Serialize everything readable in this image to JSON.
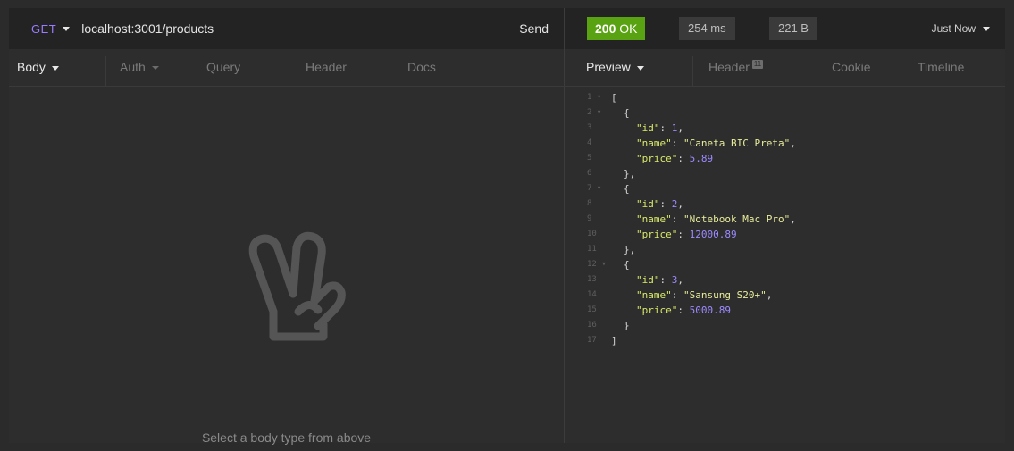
{
  "request": {
    "method": "GET",
    "url": "localhost:3001/products",
    "send_label": "Send"
  },
  "request_tabs": [
    {
      "label": "Body",
      "active": true
    },
    {
      "label": "Auth"
    },
    {
      "label": "Query"
    },
    {
      "label": "Header"
    },
    {
      "label": "Docs"
    }
  ],
  "body_empty": {
    "icon": "peace-hand-icon",
    "message": "Select a body type from above"
  },
  "response": {
    "status_code": "200",
    "status_text": "OK",
    "status_color": "#59a211",
    "time": "254 ms",
    "size": "221 B",
    "history": "Just Now"
  },
  "response_tabs": [
    {
      "label": "Preview",
      "active": true
    },
    {
      "label": "Header",
      "badge": "11"
    },
    {
      "label": "Cookie"
    },
    {
      "label": "Timeline"
    }
  ],
  "json_lines": [
    {
      "n": "1",
      "fold": true,
      "parts": [
        [
          "p",
          "["
        ]
      ],
      "indent": 0
    },
    {
      "n": "2",
      "fold": true,
      "parts": [
        [
          "p",
          "{"
        ]
      ],
      "indent": 1
    },
    {
      "n": "3",
      "parts": [
        [
          "k",
          "\"id\""
        ],
        [
          "p",
          ": "
        ],
        [
          "n",
          "1"
        ],
        [
          "p",
          ","
        ]
      ],
      "indent": 2
    },
    {
      "n": "4",
      "parts": [
        [
          "k",
          "\"name\""
        ],
        [
          "p",
          ": "
        ],
        [
          "s",
          "\"Caneta BIC Preta\""
        ],
        [
          "p",
          ","
        ]
      ],
      "indent": 2
    },
    {
      "n": "5",
      "parts": [
        [
          "k",
          "\"price\""
        ],
        [
          "p",
          ": "
        ],
        [
          "n",
          "5.89"
        ]
      ],
      "indent": 2
    },
    {
      "n": "6",
      "parts": [
        [
          "p",
          "},"
        ]
      ],
      "indent": 1
    },
    {
      "n": "7",
      "fold": true,
      "parts": [
        [
          "p",
          "{"
        ]
      ],
      "indent": 1
    },
    {
      "n": "8",
      "parts": [
        [
          "k",
          "\"id\""
        ],
        [
          "p",
          ": "
        ],
        [
          "n",
          "2"
        ],
        [
          "p",
          ","
        ]
      ],
      "indent": 2
    },
    {
      "n": "9",
      "parts": [
        [
          "k",
          "\"name\""
        ],
        [
          "p",
          ": "
        ],
        [
          "s",
          "\"Notebook Mac Pro\""
        ],
        [
          "p",
          ","
        ]
      ],
      "indent": 2
    },
    {
      "n": "10",
      "parts": [
        [
          "k",
          "\"price\""
        ],
        [
          "p",
          ": "
        ],
        [
          "n",
          "12000.89"
        ]
      ],
      "indent": 2
    },
    {
      "n": "11",
      "parts": [
        [
          "p",
          "},"
        ]
      ],
      "indent": 1
    },
    {
      "n": "12",
      "fold": true,
      "parts": [
        [
          "p",
          "{"
        ]
      ],
      "indent": 1
    },
    {
      "n": "13",
      "parts": [
        [
          "k",
          "\"id\""
        ],
        [
          "p",
          ": "
        ],
        [
          "n",
          "3"
        ],
        [
          "p",
          ","
        ]
      ],
      "indent": 2
    },
    {
      "n": "14",
      "parts": [
        [
          "k",
          "\"name\""
        ],
        [
          "p",
          ": "
        ],
        [
          "s",
          "\"Sansung S20+\""
        ],
        [
          "p",
          ","
        ]
      ],
      "indent": 2
    },
    {
      "n": "15",
      "parts": [
        [
          "k",
          "\"price\""
        ],
        [
          "p",
          ": "
        ],
        [
          "n",
          "5000.89"
        ]
      ],
      "indent": 2
    },
    {
      "n": "16",
      "parts": [
        [
          "p",
          "}"
        ]
      ],
      "indent": 1
    },
    {
      "n": "17",
      "parts": [
        [
          "p",
          "]"
        ]
      ],
      "indent": 0
    }
  ]
}
